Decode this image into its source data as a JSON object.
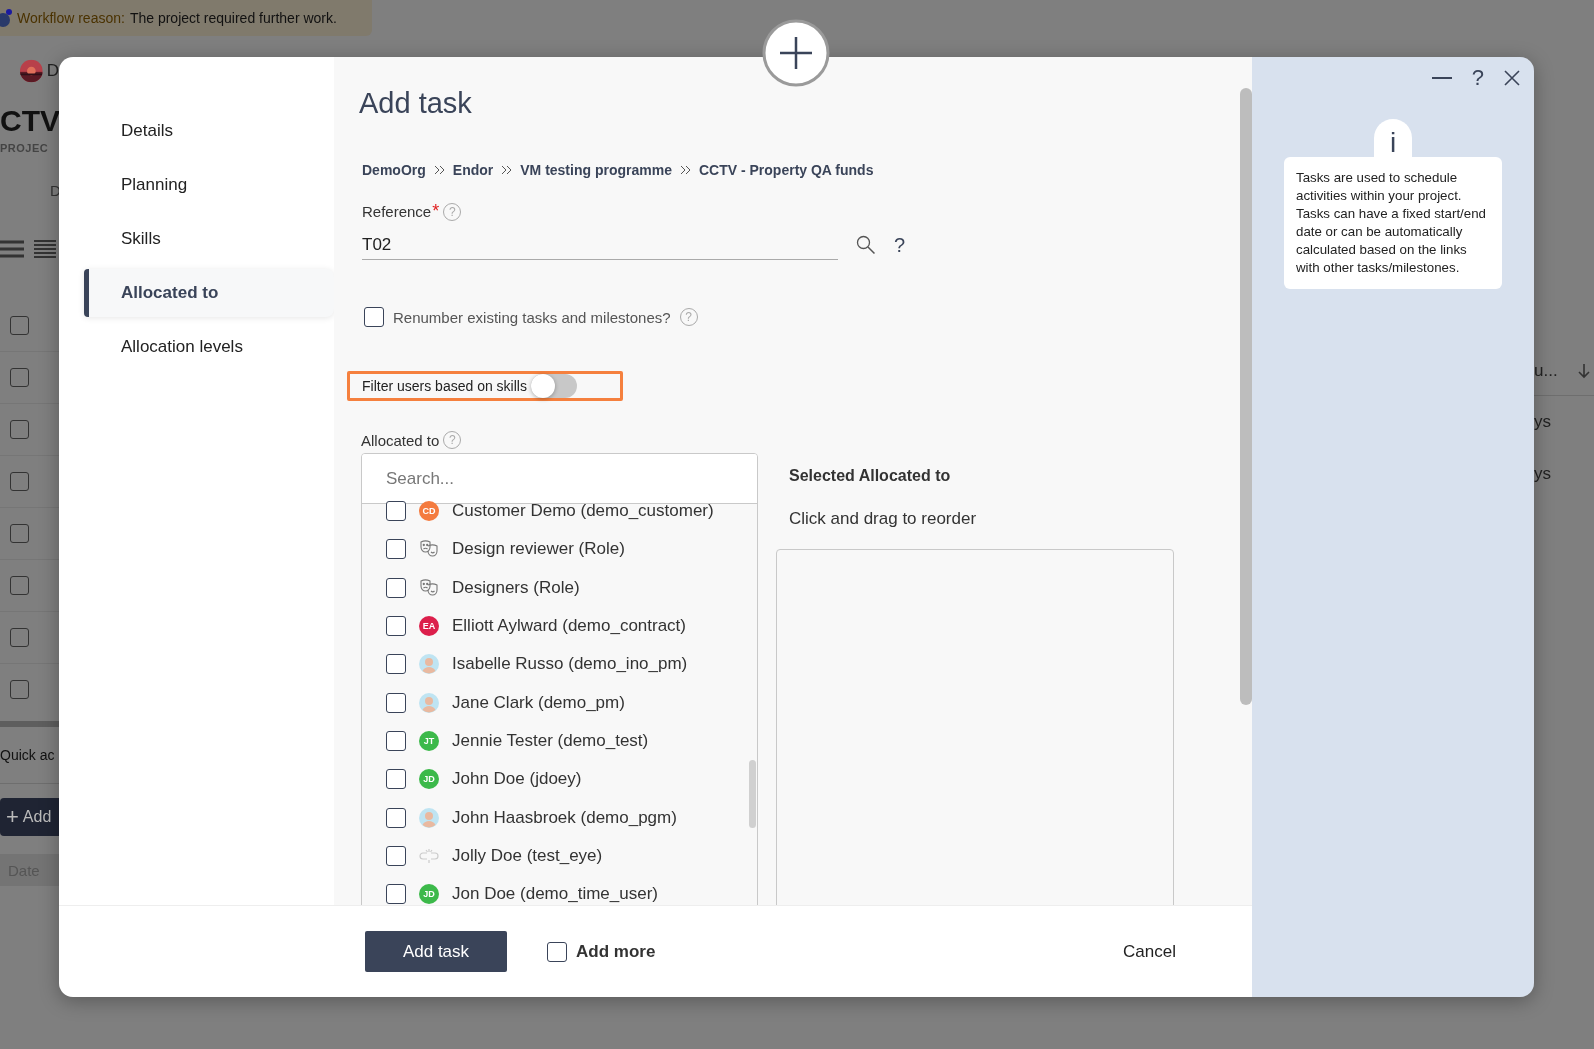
{
  "background": {
    "banner": {
      "label": "Workflow reason:",
      "text": "The project required further work."
    },
    "left": {
      "avatar_text": "D",
      "title": "CTV",
      "subtitle": "PROJEC",
      "tab": "D",
      "rows": [
        {
          "checked": false
        },
        {
          "checked": false
        },
        {
          "checked": false
        },
        {
          "checked": false
        },
        {
          "checked": false
        },
        {
          "checked": false
        },
        {
          "checked": false
        },
        {
          "checked": false
        }
      ],
      "quick": "Quick ac",
      "add_icon": "+",
      "add": "Add",
      "date": "Date"
    },
    "right": {
      "column": "u...",
      "rows": [
        "ys",
        "ys"
      ]
    }
  },
  "modal": {
    "nav": [
      {
        "label": "Details",
        "selected": false
      },
      {
        "label": "Planning",
        "selected": false
      },
      {
        "label": "Skills",
        "selected": false
      },
      {
        "label": "Allocated to",
        "selected": true
      },
      {
        "label": "Allocation levels",
        "selected": false
      }
    ],
    "title": "Add task",
    "breadcrumb": [
      "DemoOrg",
      "Endor",
      "VM testing programme",
      "CCTV - Property QA funds"
    ],
    "reference": {
      "label": "Reference",
      "required_mark": "*",
      "label_help": "?",
      "value": "T02",
      "help": "?"
    },
    "renumber": {
      "label": "Renumber existing tasks and milestones?",
      "checked": false,
      "help": "?"
    },
    "filter": {
      "label": "Filter users based on skills",
      "on": false
    },
    "allocated": {
      "label": "Allocated to",
      "help": "?",
      "placeholder": "Search...",
      "items": [
        {
          "name": "Customer Demo (demo_customer)",
          "kind": "initials",
          "initials": "CD",
          "color": "#f47b3f",
          "checked": false
        },
        {
          "name": "Design reviewer (Role)",
          "kind": "role",
          "checked": false
        },
        {
          "name": "Designers (Role)",
          "kind": "role",
          "checked": false
        },
        {
          "name": "Elliott Aylward (demo_contract)",
          "kind": "initials",
          "initials": "EA",
          "color": "#dc1f4b",
          "checked": false
        },
        {
          "name": "Isabelle Russo (demo_ino_pm)",
          "checked": false
        },
        {
          "name": "Jane Clark (demo_pm)",
          "checked": false
        },
        {
          "name": "Jennie Tester (demo_test)",
          "kind": "initials",
          "initials": "JT",
          "color": "#3cb94a",
          "checked": false
        },
        {
          "name": "John Doe (jdoey)",
          "kind": "initials",
          "initials": "JD",
          "color": "#3cb94a",
          "checked": false
        },
        {
          "name": "John Haasbroek (demo_pgm)",
          "checked": false
        },
        {
          "name": "Jolly Doe (test_eye)",
          "kind": "broken",
          "checked": false
        },
        {
          "name": "Jon Doe (demo_time_user)",
          "kind": "initials",
          "initials": "JD",
          "color": "#3cb94a",
          "checked": false
        }
      ]
    },
    "selected": {
      "title": "Selected Allocated to",
      "hint": "Click and drag to reorder"
    },
    "footer": {
      "submit": "Add task",
      "add_more": {
        "label": "Add more",
        "checked": false
      },
      "cancel": "Cancel"
    },
    "window_controls": {
      "help": "?"
    },
    "info": {
      "mark": "i",
      "text": "Tasks are used to schedule activities within your project. Tasks can have a fixed start/end date or can be automatically calculated based on the links with other tasks/milestones."
    }
  }
}
